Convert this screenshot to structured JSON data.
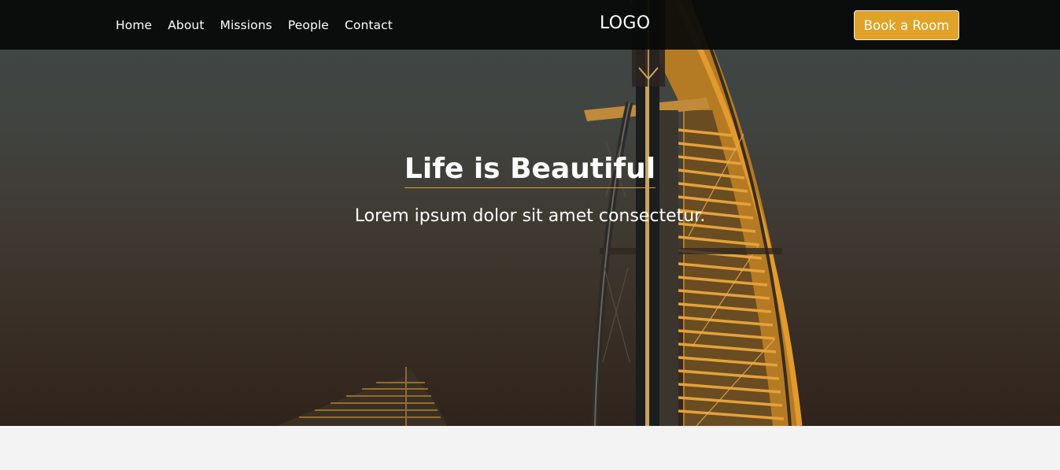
{
  "nav": {
    "links": [
      "Home",
      "About",
      "Missions",
      "People",
      "Contact"
    ],
    "logo": "LOGO",
    "cta": "Book a Room"
  },
  "hero": {
    "title": "Life is Beautiful",
    "subtitle": "Lorem ipsum dolor sit amet consectetur."
  },
  "colors": {
    "accent": "#e0a227",
    "navbar": "#080909",
    "page_background": "#f3f3f3"
  }
}
